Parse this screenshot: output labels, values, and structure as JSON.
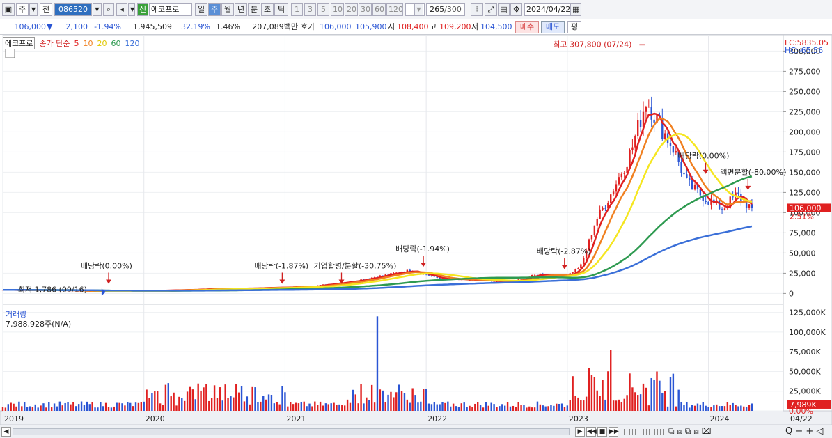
{
  "toolbar": {
    "market": "주",
    "side": "전",
    "code": "086520",
    "badge": "신",
    "name": "에코프로",
    "periods": [
      "일",
      "주",
      "월",
      "년",
      "분",
      "초",
      "틱"
    ],
    "active_period": "주",
    "minutes": [
      "1",
      "3",
      "5",
      "10",
      "20",
      "30",
      "60",
      "120"
    ],
    "count": "265",
    "count_max": "/300",
    "date": "2024/04/22"
  },
  "pricebar": {
    "price": "106,000",
    "change": "2,100",
    "change_pct": "-1.94%",
    "volume": "1,945,509",
    "vol_pct": "32.19%",
    "turnover": "1.46%",
    "amount": "207,089백만",
    "ask_label": "호가",
    "ask": "106,000",
    "bid": "105,900",
    "open_label": "시",
    "open": "108,400",
    "high_label": "고",
    "high": "109,200",
    "low_label": "저",
    "low": "104,500",
    "buy": "매수",
    "sell": "매도",
    "avg": "평"
  },
  "legend": {
    "name": "에코프로",
    "ma_label": "종가 단순",
    "ma": [
      {
        "p": "5",
        "color": "#e02020"
      },
      {
        "p": "10",
        "color": "#f08020"
      },
      {
        "p": "20",
        "color": "#e8d800"
      },
      {
        "p": "60",
        "color": "#2e9a50"
      },
      {
        "p": "120",
        "color": "#3a6fd8"
      }
    ]
  },
  "colors": {
    "up": "#e02020",
    "down": "#2a55d4",
    "ma5": "#e02020",
    "ma10": "#f08020",
    "ma20": "#f5e620",
    "ma60": "#2e9a50",
    "ma120": "#3a6fd8"
  },
  "chart_data": {
    "type": "candlestick",
    "price_axis": {
      "ticks": [
        0,
        25000,
        50000,
        75000,
        100000,
        125000,
        150000,
        175000,
        200000,
        225000,
        250000,
        275000,
        300000
      ],
      "labels": [
        "0",
        "25,000",
        "50,000",
        "75,000",
        "100,000",
        "125,000",
        "150,000",
        "175,000",
        "200,000",
        "225,000",
        "250,000",
        "275,000",
        "300,000"
      ],
      "ylim": [
        -10000,
        315000
      ]
    },
    "volume_axis": {
      "ticks": [
        0,
        25000,
        50000,
        75000,
        100000,
        125000
      ],
      "labels": [
        "0.00%",
        "25,000K",
        "50,000K",
        "75,000K",
        "100,000K",
        "125,000K"
      ],
      "ylim": [
        0,
        130000
      ]
    },
    "x_labels": [
      "2019",
      "2020",
      "2021",
      "2022",
      "2023",
      "2024",
      "04/22"
    ],
    "lc": "LC:5835.05",
    "hc": "HC:-65.56",
    "current_price_tag": "106,000",
    "current_pct_tag": "2.51%",
    "volume_title": "거래량",
    "volume_value": "7,988,928주(N/A)",
    "volume_tag": "7,989K",
    "annotations": [
      {
        "text": "최고 307,800 (07/24)",
        "x": 2023.56,
        "y": 307800
      },
      {
        "text": "최저 1,786 (09/16)",
        "x": 2019.7,
        "y": 1786
      },
      {
        "text": "배당락(0.00%)",
        "x": 2019.75,
        "y": 12000
      },
      {
        "text": "배당락(-1.87%)",
        "x": 2020.98,
        "y": 12000
      },
      {
        "text": "기업합병/분할(-30.75%)",
        "x": 2021.4,
        "y": 12000
      },
      {
        "text": "배당락(-1.94%)",
        "x": 2021.98,
        "y": 33000
      },
      {
        "text": "배당락(-2.87%)",
        "x": 2022.98,
        "y": 30000
      },
      {
        "text": "배당락(0.00%)",
        "x": 2023.98,
        "y": 148000
      },
      {
        "text": "액면분할(-80.00%)",
        "x": 2024.28,
        "y": 128000
      }
    ],
    "series_close": [
      [
        2019.0,
        4500
      ],
      [
        2019.5,
        3800
      ],
      [
        2019.7,
        2200
      ],
      [
        2020.0,
        3000
      ],
      [
        2020.5,
        5500
      ],
      [
        2020.9,
        7000
      ],
      [
        2021.2,
        9000
      ],
      [
        2021.5,
        16000
      ],
      [
        2021.75,
        24000
      ],
      [
        2021.9,
        29000
      ],
      [
        2022.1,
        18000
      ],
      [
        2022.4,
        16000
      ],
      [
        2022.6,
        14000
      ],
      [
        2022.8,
        24000
      ],
      [
        2023.0,
        22000
      ],
      [
        2023.1,
        35000
      ],
      [
        2023.2,
        90000
      ],
      [
        2023.3,
        120000
      ],
      [
        2023.45,
        175000
      ],
      [
        2023.56,
        240000
      ],
      [
        2023.65,
        210000
      ],
      [
        2023.75,
        180000
      ],
      [
        2023.85,
        135000
      ],
      [
        2024.0,
        115000
      ],
      [
        2024.1,
        105000
      ],
      [
        2024.2,
        122000
      ],
      [
        2024.3,
        106000
      ]
    ]
  },
  "bottombar": {
    "zoom": "Q"
  }
}
